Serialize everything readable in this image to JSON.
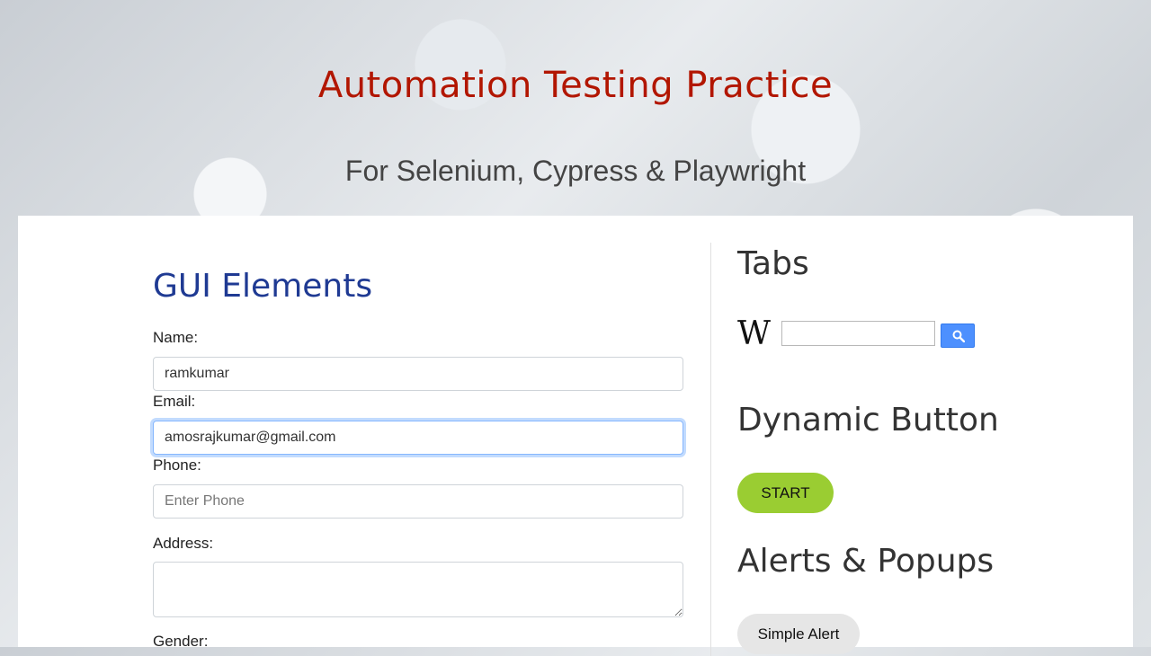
{
  "header": {
    "title": "Automation Testing Practice",
    "subtitle": "For Selenium, Cypress & Playwright"
  },
  "gui": {
    "title": "GUI Elements",
    "name_label": "Name:",
    "name_value": "ramkumar",
    "email_label": "Email:",
    "email_value": "amosrajkumar@gmail.com",
    "phone_label": "Phone:",
    "phone_placeholder": "Enter Phone",
    "address_label": "Address:",
    "gender_label": "Gender:"
  },
  "tabs": {
    "title": "Tabs",
    "wiki_logo": "W",
    "search_icon": "search-icon"
  },
  "dynamic": {
    "title": "Dynamic Button",
    "start_label": "START"
  },
  "alerts": {
    "title": "Alerts & Popups",
    "simple_alert_label": "Simple Alert"
  },
  "colors": {
    "title": "#b21600",
    "gui_title": "#1f3a93",
    "start_button": "#9acd32",
    "search_button": "#4d90fe"
  }
}
